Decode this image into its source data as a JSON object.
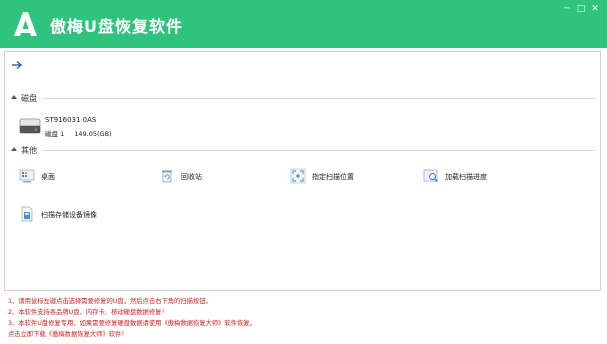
{
  "app": {
    "title": "傲梅U盘恢复软件",
    "accent": "#2fc47e"
  },
  "window_buttons": {
    "minimize": "─",
    "maximize": "□",
    "close": "✕"
  },
  "sections": {
    "disk": {
      "label": "磁盘"
    },
    "other": {
      "label": "其他"
    }
  },
  "disk": {
    "name": "ST916031 0AS",
    "index": "磁盘 1",
    "size": "149.05(GB)"
  },
  "others": {
    "desktop": "桌面",
    "recycle": "回收站",
    "location": "指定扫描位置",
    "load_scan": "加载扫描进度",
    "image_scan": "扫描存储设备镜像"
  },
  "notes": [
    "1、请用鼠标左键点击选择需要修复的U盘，然后点击右下角的扫描按钮。",
    "2、本软件支持各品牌U盘、内存卡、移动硬盘数据修复！",
    "3、本软件U盘修复专用，如果需要修复硬盘数据请使用《傲梅数据恢复大师》软件恢复。",
    "点击立即下载《傲梅数据恢复大师》软件！"
  ]
}
